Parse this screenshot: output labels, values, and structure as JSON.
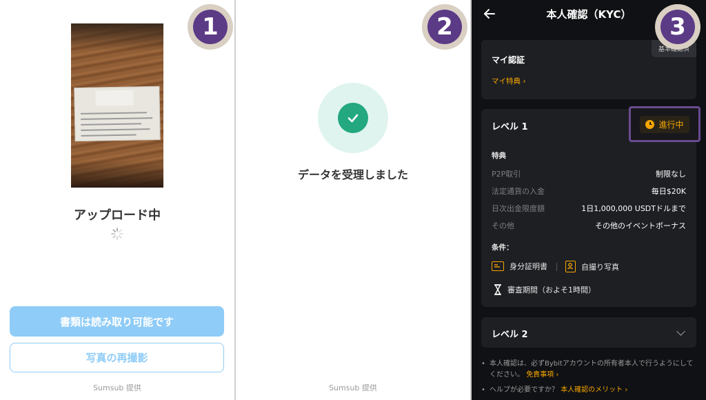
{
  "steps": [
    "1",
    "2",
    "3"
  ],
  "panel1": {
    "status": "アップロード中",
    "primary_button": "書類は読み取り可能です",
    "retake_button": "写真の再撮影",
    "provider": "Sumsub 提供"
  },
  "panel2": {
    "message": "データを受理しました",
    "provider": "Sumsub 提供"
  },
  "panel3": {
    "title": "本人確認（KYC）",
    "my_verification": {
      "title": "マイ認証",
      "tag": "基本確認済",
      "link": "マイ特典"
    },
    "level1": {
      "title": "レベル 1",
      "status": "進行中",
      "benefits_label": "特典",
      "benefits": [
        {
          "key": "P2P取引",
          "value": "制限なし"
        },
        {
          "key": "法定通貨の入金",
          "value": "毎日$20K"
        },
        {
          "key": "日次出金限度額",
          "value": "1日1,000,000 USDTドルまで"
        },
        {
          "key": "その他",
          "value": "その他のイベントボーナス"
        }
      ],
      "conditions_label": "条件：",
      "conditions": [
        "身分証明書",
        "自撮り写真",
        "審査期間（およそ1時間）"
      ]
    },
    "level2": {
      "title": "レベル 2"
    },
    "notes": {
      "note1_text": "本人確認は、必ずBybitアカウントの所有者本人で行うようにしてください。",
      "note1_link": "免責事項",
      "note2_text": "ヘルプが必要ですか？",
      "note2_link": "本人確認のメリット"
    }
  },
  "colors": {
    "accent_blue": "#8fccf7",
    "success_green": "#23a87f",
    "bybit_orange": "#f7a600",
    "badge_purple": "#5b3a86"
  }
}
